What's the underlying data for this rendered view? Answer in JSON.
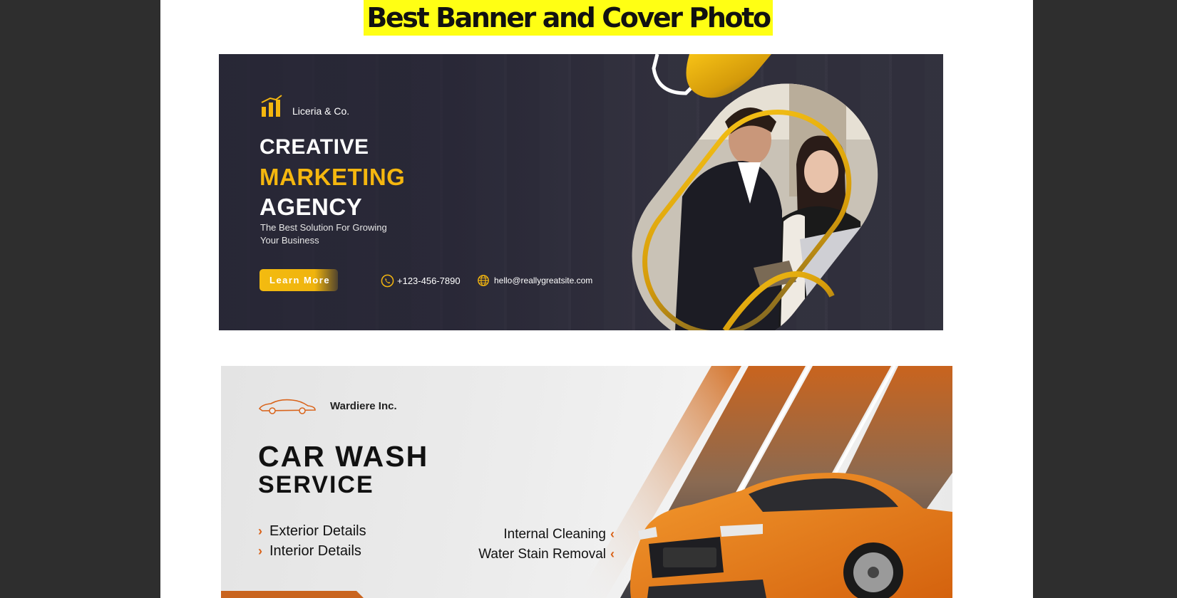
{
  "heading": "Best Banner and Cover Photo",
  "colors": {
    "highlight": "#ffff14",
    "banner1_accent": "#f5b70f",
    "banner1_bg": "#2c2b3a",
    "banner2_accent": "#d9631a"
  },
  "banner1": {
    "company": "Liceria & Co.",
    "title_line1": "CREATIVE",
    "title_line2": "MARKETING",
    "title_line3": "AGENCY",
    "subtitle_line1": "The Best Solution For Growing",
    "subtitle_line2": "Your Business",
    "button_label": "Learn More",
    "phone": "+123-456-7890",
    "email": "hello@reallygreatsite.com",
    "icons": [
      "bar-chart-logo-icon",
      "phone-icon",
      "globe-icon"
    ]
  },
  "banner2": {
    "company": "Wardiere Inc.",
    "title_line1": "CAR WASH",
    "title_line2": "SERVICE",
    "left_items": [
      "Exterior Details",
      "Interior Details"
    ],
    "right_items": [
      "Internal Cleaning",
      "Water Stain Removal"
    ],
    "icons": [
      "car-logo-icon",
      "chevron-right-icon",
      "chevron-left-icon"
    ]
  }
}
